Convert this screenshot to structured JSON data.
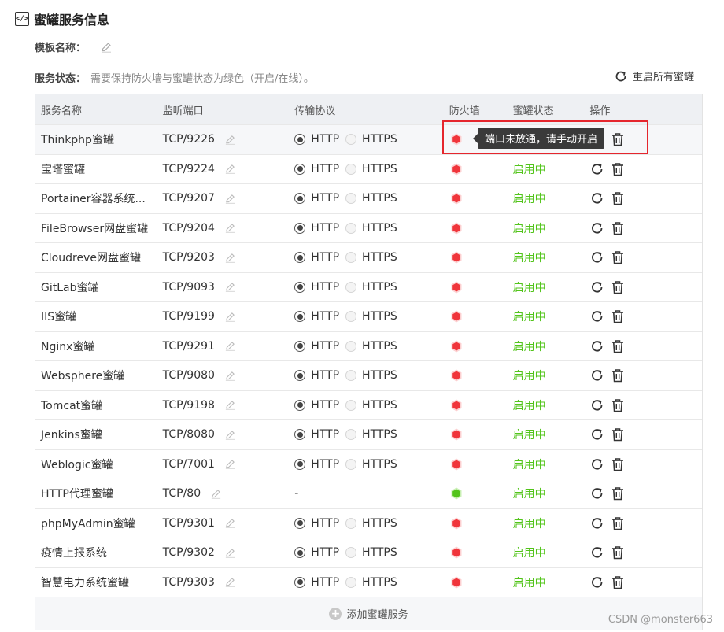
{
  "section": {
    "title": "蜜罐服务信息",
    "icon": "code-icon"
  },
  "template": {
    "label": "模板名称："
  },
  "service_status": {
    "label": "服务状态：",
    "hint": "需要保持防火墙与蜜罐状态为绿色（开启/在线）。"
  },
  "restart_all_label": "重启所有蜜罐",
  "columns": {
    "name": "服务名称",
    "port": "监听端口",
    "protocol": "传输协议",
    "firewall": "防火墙",
    "status": "蜜罐状态",
    "ops": "操作"
  },
  "colors": {
    "firewall_red": "#f0353b",
    "firewall_green": "#52c41a",
    "status_green": "#52c41a",
    "highlight_red": "#e5262d"
  },
  "rows": [
    {
      "name": "Thinkphp蜜罐",
      "port": "TCP/9226",
      "http": "HTTP",
      "https": "HTTPS",
      "firewall": "red",
      "status": ""
    },
    {
      "name": "宝塔蜜罐",
      "port": "TCP/9224",
      "http": "HTTP",
      "https": "HTTPS",
      "firewall": "red",
      "status": "启用中"
    },
    {
      "name": "Portainer容器系统...",
      "port": "TCP/9207",
      "http": "HTTP",
      "https": "HTTPS",
      "firewall": "red",
      "status": "启用中"
    },
    {
      "name": "FileBrowser网盘蜜罐",
      "port": "TCP/9204",
      "http": "HTTP",
      "https": "HTTPS",
      "firewall": "red",
      "status": "启用中"
    },
    {
      "name": "Cloudreve网盘蜜罐",
      "port": "TCP/9203",
      "http": "HTTP",
      "https": "HTTPS",
      "firewall": "red",
      "status": "启用中"
    },
    {
      "name": "GitLab蜜罐",
      "port": "TCP/9093",
      "http": "HTTP",
      "https": "HTTPS",
      "firewall": "red",
      "status": "启用中"
    },
    {
      "name": "IIS蜜罐",
      "port": "TCP/9199",
      "http": "HTTP",
      "https": "HTTPS",
      "firewall": "red",
      "status": "启用中"
    },
    {
      "name": "Nginx蜜罐",
      "port": "TCP/9291",
      "http": "HTTP",
      "https": "HTTPS",
      "firewall": "red",
      "status": "启用中"
    },
    {
      "name": "Websphere蜜罐",
      "port": "TCP/9080",
      "http": "HTTP",
      "https": "HTTPS",
      "firewall": "red",
      "status": "启用中"
    },
    {
      "name": "Tomcat蜜罐",
      "port": "TCP/9198",
      "http": "HTTP",
      "https": "HTTPS",
      "firewall": "red",
      "status": "启用中"
    },
    {
      "name": "Jenkins蜜罐",
      "port": "TCP/8080",
      "http": "HTTP",
      "https": "HTTPS",
      "firewall": "red",
      "status": "启用中"
    },
    {
      "name": "Weblogic蜜罐",
      "port": "TCP/7001",
      "http": "HTTP",
      "https": "HTTPS",
      "firewall": "red",
      "status": "启用中"
    },
    {
      "name": "HTTP代理蜜罐",
      "port": "TCP/80",
      "proto_text": "-",
      "firewall": "green",
      "status": "启用中"
    },
    {
      "name": "phpMyAdmin蜜罐",
      "port": "TCP/9301",
      "http": "HTTP",
      "https": "HTTPS",
      "firewall": "red",
      "status": "启用中"
    },
    {
      "name": "疫情上报系统",
      "port": "TCP/9302",
      "http": "HTTP",
      "https": "HTTPS",
      "firewall": "red",
      "status": "启用中"
    },
    {
      "name": "智慧电力系统蜜罐",
      "port": "TCP/9303",
      "http": "HTTP",
      "https": "HTTPS",
      "firewall": "red",
      "status": "启用中"
    }
  ],
  "add_label": "添加蜜罐服务",
  "tooltip": "端口未放通，请手动开启",
  "watermark": "CSDN @monster663"
}
